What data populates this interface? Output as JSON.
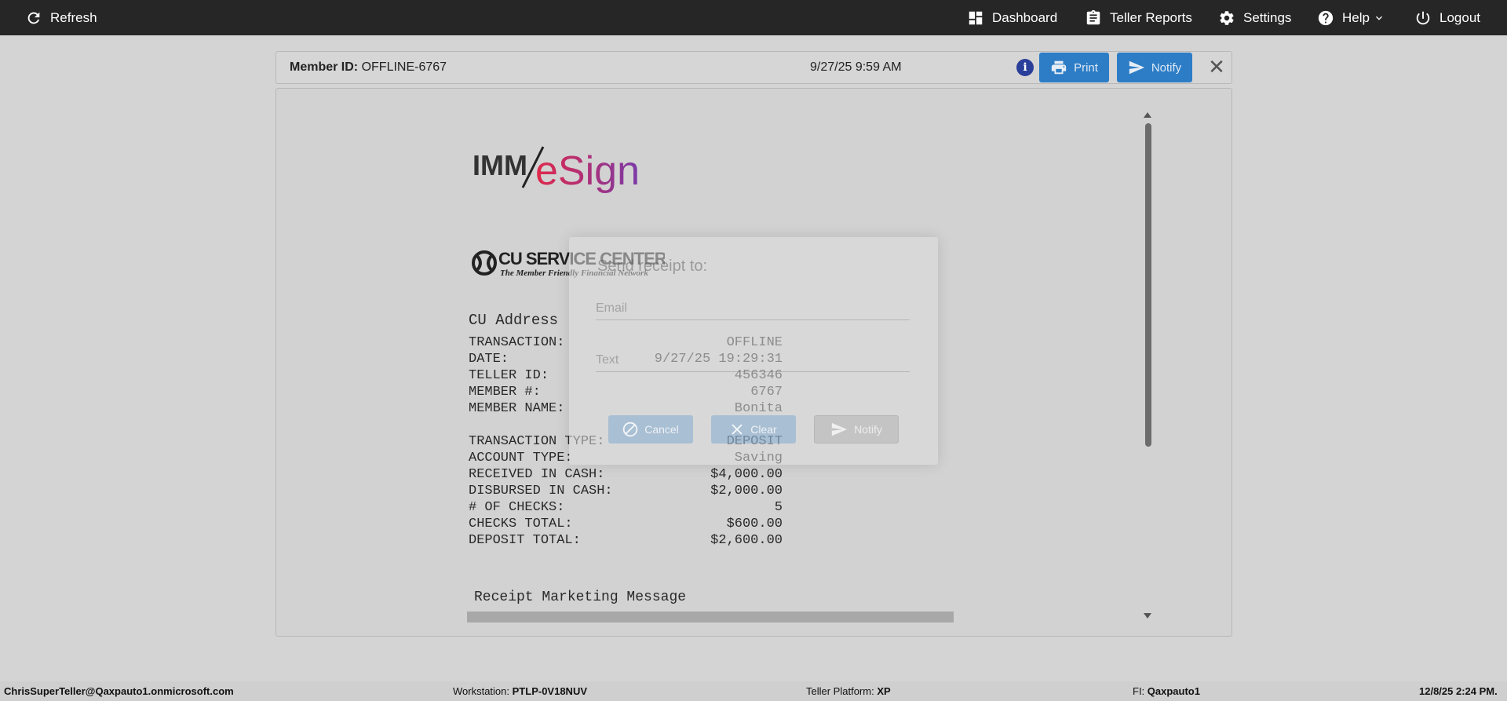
{
  "topbar": {
    "refresh": "Refresh",
    "dashboard": "Dashboard",
    "teller_reports": "Teller Reports",
    "settings": "Settings",
    "help": "Help",
    "logout": "Logout"
  },
  "header": {
    "member_label": "Member ID:",
    "member_value": "OFFLINE-6767",
    "datetime": "9/27/25 9:59 AM",
    "info": "i",
    "print": "Print",
    "notify": "Notify",
    "close": "✕"
  },
  "receipt": {
    "logo_imm": "IMM",
    "logo_esign": "eSign",
    "cu_name": "CU SERVICE CENTERS",
    "cu_tagline": "The Member Friendly Financial Network",
    "cu_address": "CU Address",
    "lines_top": [
      {
        "label": "TRANSACTION:",
        "value": "OFFLINE"
      },
      {
        "label": "DATE:",
        "value": "9/27/25 19:29:31"
      },
      {
        "label": "TELLER ID:",
        "value": "456346"
      },
      {
        "label": "MEMBER #:",
        "value": "6767"
      },
      {
        "label": "MEMBER NAME:",
        "value": "Bonita"
      }
    ],
    "lines_bottom": [
      {
        "label": "TRANSACTION TYPE:",
        "value": "DEPOSIT"
      },
      {
        "label": "ACCOUNT TYPE:",
        "value": "Saving"
      },
      {
        "label": "RECEIVED IN CASH:",
        "value": "$4,000.00"
      },
      {
        "label": "DISBURSED IN CASH:",
        "value": "$2,000.00"
      },
      {
        "label": "# OF CHECKS:",
        "value": "5"
      },
      {
        "label": "CHECKS TOTAL:",
        "value": "$600.00"
      },
      {
        "label": "DEPOSIT TOTAL:",
        "value": "$2,600.00"
      }
    ],
    "marketing": "Receipt Marketing Message"
  },
  "modal": {
    "title": "Send receipt to:",
    "email_placeholder": "Email",
    "text_placeholder": "Text",
    "cancel": "Cancel",
    "clear": "Clear",
    "notify": "Notify"
  },
  "footer": {
    "user": "ChrisSuperTeller@Qaxpauto1.onmicrosoft.com",
    "workstation_label": "Workstation:",
    "workstation": "PTLP-0V18NUV",
    "platform_label": "Teller Platform:",
    "platform": "XP",
    "fi_label": "FI:",
    "fi": "Qaxpauto1",
    "datetime": "12/8/25 2:24 PM."
  },
  "colors": {
    "topbar": "#262626",
    "primary_button": "#2d7dc6",
    "info_icon": "#2a3f9a",
    "esign_gradient_start": "#e0284a",
    "esign_gradient_end": "#7a3aa8"
  }
}
